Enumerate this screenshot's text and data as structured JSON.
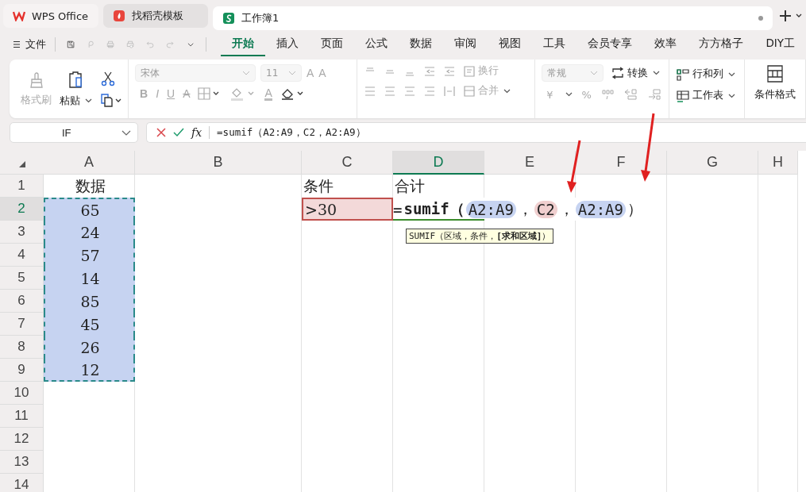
{
  "tabs": [
    {
      "label": "WPS Office",
      "kind": "wps",
      "selected": false
    },
    {
      "label": "找稻壳模板",
      "kind": "docer",
      "selected": false
    },
    {
      "label": "工作簿1",
      "kind": "sheet",
      "selected": true
    }
  ],
  "menu": {
    "file": "文件",
    "tabs": [
      {
        "label": "开始",
        "selected": true
      },
      {
        "label": "插入",
        "selected": false
      },
      {
        "label": "页面",
        "selected": false
      },
      {
        "label": "公式",
        "selected": false
      },
      {
        "label": "数据",
        "selected": false
      },
      {
        "label": "审阅",
        "selected": false
      },
      {
        "label": "视图",
        "selected": false
      },
      {
        "label": "工具",
        "selected": false
      },
      {
        "label": "会员专享",
        "selected": false
      },
      {
        "label": "效率",
        "selected": false
      },
      {
        "label": "方方格子",
        "selected": false
      },
      {
        "label": "DIY工",
        "selected": false
      }
    ]
  },
  "ribbon": {
    "format_painter": {
      "label": "格式刷",
      "disabled": true
    },
    "paste": {
      "label": "粘贴",
      "disabled": false
    },
    "font": {
      "name": "宋体",
      "size": "11",
      "disabled": true,
      "buttons": [
        {
          "text": "A",
          "kind": "grow"
        },
        {
          "text": "A",
          "kind": "shrink"
        },
        {
          "text": "B",
          "kind": "bold"
        },
        {
          "text": "I",
          "kind": "italic"
        },
        {
          "text": "U",
          "kind": "underline"
        },
        {
          "text": "A",
          "kind": "strike"
        },
        {
          "text": "A",
          "kind": "color"
        }
      ]
    },
    "alignment": {
      "wrap": "换行",
      "merge": "合并",
      "disabled": true
    },
    "number": {
      "format": "常规",
      "convert": "转换",
      "currency": "¥",
      "percent": "%",
      "disabled": true
    },
    "rows_cols": "行和列",
    "sheet": "工作表",
    "conditional": "条件格式"
  },
  "formula_bar": {
    "name_box": "IF",
    "fx": "fx",
    "formula": "=sumif（A2:A9，C2，A2:A9）"
  },
  "columns": [
    {
      "label": "A",
      "selected": false
    },
    {
      "label": "B",
      "selected": false
    },
    {
      "label": "C",
      "selected": false
    },
    {
      "label": "D",
      "selected": true
    },
    {
      "label": "E",
      "selected": false
    },
    {
      "label": "F",
      "selected": false
    },
    {
      "label": "G",
      "selected": false
    },
    {
      "label": "H",
      "selected": false
    }
  ],
  "rows": [
    {
      "label": "1",
      "selected": false,
      "cells": {
        "A": {
          "text": "数据"
        },
        "C": {
          "text": "条件"
        },
        "D": {
          "text": "合计"
        }
      }
    },
    {
      "label": "2",
      "selected": true,
      "cells": {
        "A": {
          "text": "65",
          "color": "#c6d3f1"
        },
        "C": {
          "text": ">30",
          "color": "#f3d9d9"
        }
      }
    },
    {
      "label": "3",
      "selected": false,
      "cells": {
        "A": {
          "text": "24",
          "color": "#c6d3f1"
        }
      }
    },
    {
      "label": "4",
      "selected": false,
      "cells": {
        "A": {
          "text": "57",
          "color": "#c6d3f1"
        }
      }
    },
    {
      "label": "5",
      "selected": false,
      "cells": {
        "A": {
          "text": "14",
          "color": "#c6d3f1"
        }
      }
    },
    {
      "label": "6",
      "selected": false,
      "cells": {
        "A": {
          "text": "85",
          "color": "#c6d3f1"
        }
      }
    },
    {
      "label": "7",
      "selected": false,
      "cells": {
        "A": {
          "text": "45",
          "color": "#c6d3f1"
        }
      }
    },
    {
      "label": "8",
      "selected": false,
      "cells": {
        "A": {
          "text": "26",
          "color": "#c6d3f1"
        }
      }
    },
    {
      "label": "9",
      "selected": false,
      "cells": {
        "A": {
          "text": "12",
          "color": "#c6d3f1"
        }
      }
    },
    {
      "label": "10",
      "selected": false,
      "cells": {}
    },
    {
      "label": "11",
      "selected": false,
      "cells": {}
    },
    {
      "label": "12",
      "selected": false,
      "cells": {}
    },
    {
      "label": "13",
      "selected": false,
      "cells": {}
    },
    {
      "label": "14",
      "selected": false,
      "cells": {}
    }
  ],
  "editor": {
    "parts": [
      {
        "text": "=",
        "kind": "op"
      },
      {
        "text": "sumif（",
        "kind": "func"
      },
      {
        "text": "A2:A9",
        "kind": "ref",
        "color": "#c6d3f1"
      },
      {
        "text": "，",
        "kind": "op"
      },
      {
        "text": "C2",
        "kind": "ref",
        "color": "#f0cfcf"
      },
      {
        "text": "，",
        "kind": "op"
      },
      {
        "text": "A2:A9",
        "kind": "ref",
        "color": "#c6d3f1"
      },
      {
        "text": "）",
        "kind": "op"
      }
    ],
    "tooltip": "SUMIF（区域，条件，**[求和区域]**）"
  }
}
